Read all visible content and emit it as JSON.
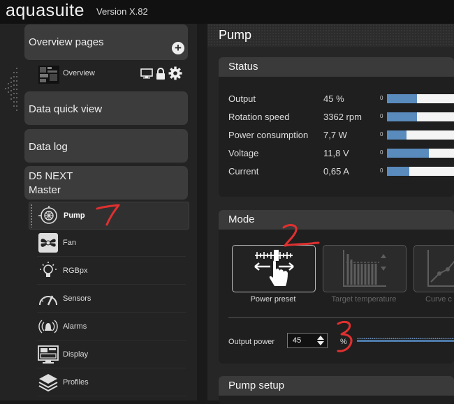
{
  "app": {
    "name": "aquasuite",
    "version": "Version X.82"
  },
  "sidebar": {
    "overview_pages": {
      "label": "Overview pages",
      "add_icon": "plus-circle-icon"
    },
    "overview_item": {
      "label": "Overview",
      "icons": [
        "monitor-icon",
        "lock-icon",
        "gear-icon"
      ]
    },
    "data_quick_view": "Data quick view",
    "data_log": "Data log",
    "device": {
      "line1": "D5 NEXT",
      "line2": "Master"
    },
    "items": [
      {
        "label": "Pump",
        "icon": "pump-icon",
        "active": true
      },
      {
        "label": "Fan",
        "icon": "fan-icon"
      },
      {
        "label": "RGBpx",
        "icon": "lightbulb-icon"
      },
      {
        "label": "Sensors",
        "icon": "gauge-icon"
      },
      {
        "label": "Alarms",
        "icon": "alarm-bell-icon"
      },
      {
        "label": "Display",
        "icon": "display-icon"
      },
      {
        "label": "Profiles",
        "icon": "layers-icon"
      }
    ]
  },
  "page": {
    "title": "Pump"
  },
  "status": {
    "title": "Status",
    "rows": [
      {
        "name": "Output",
        "value": "45 %",
        "min": "0",
        "fraction": 0.45
      },
      {
        "name": "Rotation speed",
        "value": "3362 rpm",
        "min": "0",
        "fraction": 0.45
      },
      {
        "name": "Power consumption",
        "value": "7,7 W",
        "min": "0",
        "fraction": 0.29
      },
      {
        "name": "Voltage",
        "value": "11,8 V",
        "min": "0",
        "fraction": 0.62
      },
      {
        "name": "Current",
        "value": "0,65 A",
        "min": "0",
        "fraction": 0.33
      }
    ]
  },
  "mode": {
    "title": "Mode",
    "options": [
      {
        "label": "Power preset",
        "icon": "power-preset-icon",
        "selected": true
      },
      {
        "label": "Target temperature",
        "icon": "target-temperature-icon",
        "selected": false
      },
      {
        "label": "Curve c",
        "icon": "curve-controller-icon",
        "selected": false
      }
    ],
    "output_power": {
      "label": "Output power",
      "value": "45",
      "unit": "%",
      "fraction": 0.45
    }
  },
  "pump_setup": {
    "title": "Pump setup"
  },
  "annotations": [
    "1",
    "2",
    "3"
  ],
  "colors": {
    "accent_bar": "#5a8bbd",
    "annotation": "#e03030",
    "panel_header": "#3a3a3a"
  }
}
